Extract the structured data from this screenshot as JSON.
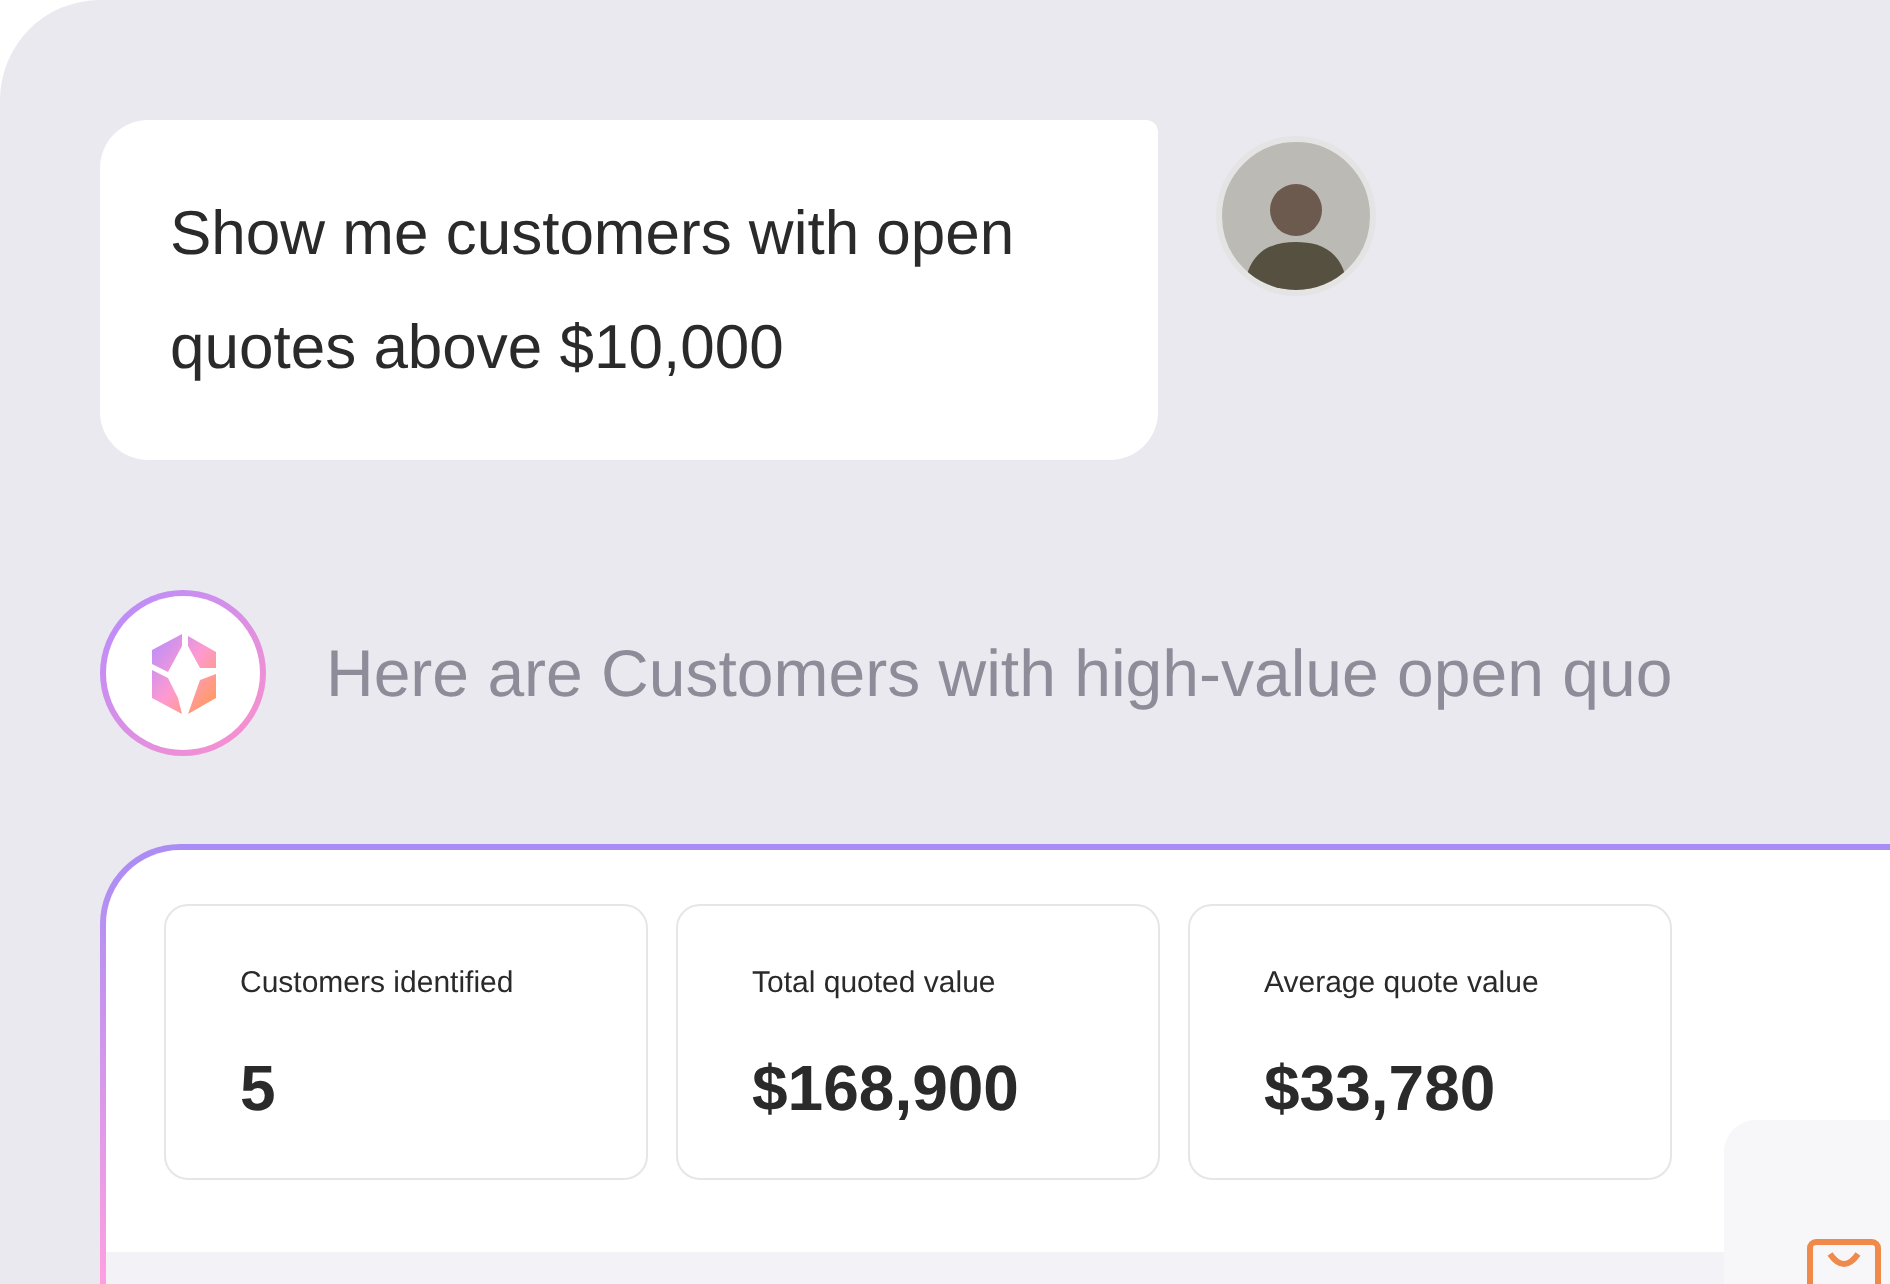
{
  "user_message": {
    "text": "Show me customers with open quotes above $10,000"
  },
  "assistant_message": {
    "text": "Here are Customers with high-value open quo"
  },
  "stats": [
    {
      "label": "Customers identified",
      "value": "5"
    },
    {
      "label": "Total quoted value",
      "value": "$168,900"
    },
    {
      "label": "Average quote value",
      "value": "$33,780"
    }
  ]
}
